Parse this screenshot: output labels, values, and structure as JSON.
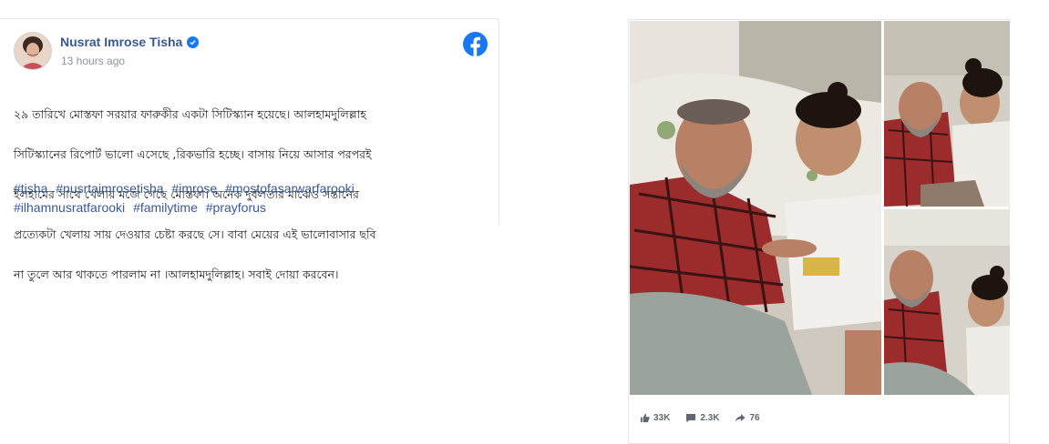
{
  "post": {
    "author": "Nusrat Imrose Tisha",
    "timestamp": "13 hours ago",
    "verified_icon": "verified-badge-icon",
    "platform_icon": "facebook-logo-icon",
    "text_lines": [
      "২৯ তারিখে মোস্তফা সরয়ার ফারুকীর একটা সিটিস্ক্যান হয়েছে। আলহামদুলিল্লাহ",
      "সিটিস্ক্যানের রিপোর্ট ভালো এসেছে ,রিকভারি হচ্ছে। বাসায় নিয়ে আসার পরপরই",
      "ইলহামের সাথে খেলায় মজে গেছে মোস্তফা। অনেক দুর্বলতার মাঝেও সন্তানের",
      "প্রত্যেকটা খেলায় সায় দেওয়ার চেষ্টা করছে সে। বাবা মেয়ের এই ভালোবাসার ছবি",
      "না তুলে আর থাকতে পারলাম না ।আলহামদুলিল্লাহ। সবাই দোয়া করবেন।"
    ],
    "hashtags": [
      "#tisha",
      "#nusrtaimrosetisha",
      "#imrose",
      "#mostofasarwarfarooki",
      "#ilhamnusratfarooki",
      "#familytime",
      "#prayforus"
    ],
    "colors": {
      "link": "#385898",
      "facebook_blue": "#1877f2",
      "meta_gray": "#90949c"
    }
  },
  "photo_post": {
    "photos": [
      {
        "description": "father-daughter-main-photo"
      },
      {
        "description": "father-daughter-photo-2"
      },
      {
        "description": "father-daughter-photo-3"
      }
    ],
    "reactions": {
      "likes": "33K",
      "comments": "2.3K",
      "shares": "76"
    },
    "icons": {
      "likes": "thumbs-up-icon",
      "comments": "comment-icon",
      "shares": "share-icon"
    }
  }
}
